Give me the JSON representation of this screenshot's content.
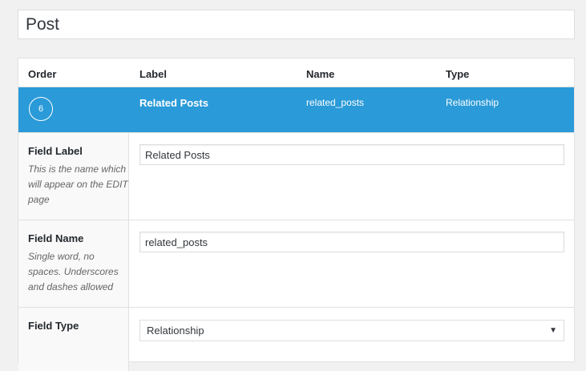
{
  "post_title": "Post",
  "table": {
    "headers": {
      "order": "Order",
      "label": "Label",
      "name": "Name",
      "type": "Type"
    },
    "field": {
      "order": "6",
      "label": "Related Posts",
      "name": "related_posts",
      "type": "Relationship"
    }
  },
  "settings": {
    "field_label": {
      "title": "Field Label",
      "description": "This is the name which will appear on the EDIT page",
      "value": "Related Posts"
    },
    "field_name": {
      "title": "Field Name",
      "description": "Single word, no spaces. Underscores and dashes allowed",
      "value": "related_posts"
    },
    "field_type": {
      "title": "Field Type",
      "selected": "Relationship",
      "arrow": "▼"
    }
  },
  "colors": {
    "accent": "#2a9ad8"
  }
}
